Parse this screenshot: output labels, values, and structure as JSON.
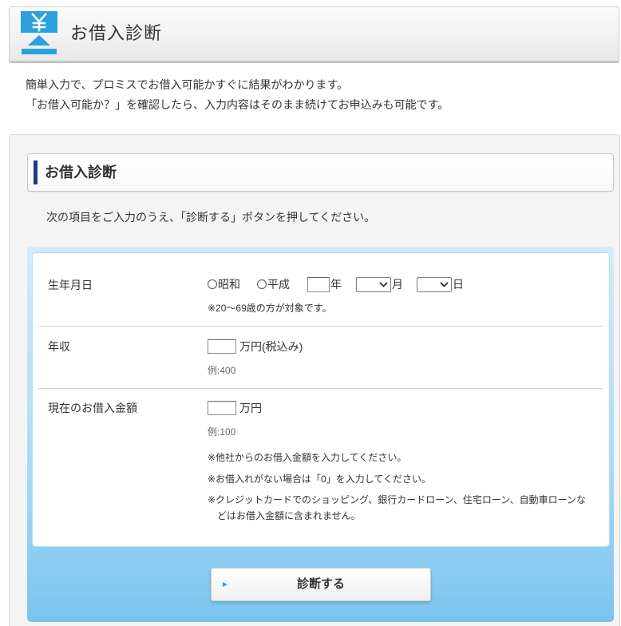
{
  "colors": {
    "accent_blue": "#2aa1de",
    "heading_bar": "#1b3f7d",
    "text": "#333333",
    "panel_blue_top": "#d2ebfb",
    "panel_blue_bottom": "#79c4ee"
  },
  "icons": {
    "header": "yen-upload-icon",
    "radio": "radio-circle-icon",
    "select_arrow": "chevron-down-icon",
    "submit_arrow": "triangle-right-icon"
  },
  "header": {
    "title": "お借入診断"
  },
  "intro": {
    "lines": [
      "簡単入力で、プロミスでお借入可能かすぐに結果がわかります。",
      "「お借入可能か？」を確認したら、入力内容はそのまま続けてお申込みも可能です。"
    ]
  },
  "section": {
    "heading": "お借入診断",
    "instruction": "次の項目をご入力のうえ、「診断する」ボタンを押してください。"
  },
  "form": {
    "birth_date": {
      "label": "生年月日",
      "era_options": [
        {
          "label": "昭和",
          "selected": false
        },
        {
          "label": "平成",
          "selected": false
        }
      ],
      "year": {
        "value": "",
        "unit": "年"
      },
      "month": {
        "value": "",
        "unit": "月"
      },
      "day": {
        "value": "",
        "unit": "日"
      },
      "note": "※20～69歳の方が対象です。"
    },
    "annual_income": {
      "label": "年収",
      "value": "",
      "unit": "万円(税込み)",
      "example": "例:400"
    },
    "current_borrowing": {
      "label": "現在のお借入金額",
      "value": "",
      "unit": "万円",
      "example": "例:100",
      "notes": [
        "※他社からのお借入金額を入力してください。",
        "※お借入れがない場合は「0」を入力してください。",
        "※クレジットカードでのショッピング、銀行カードローン、住宅ローン、自動車ローンなどはお借入金額に含まれません。"
      ]
    },
    "submit_label": "診断する"
  }
}
